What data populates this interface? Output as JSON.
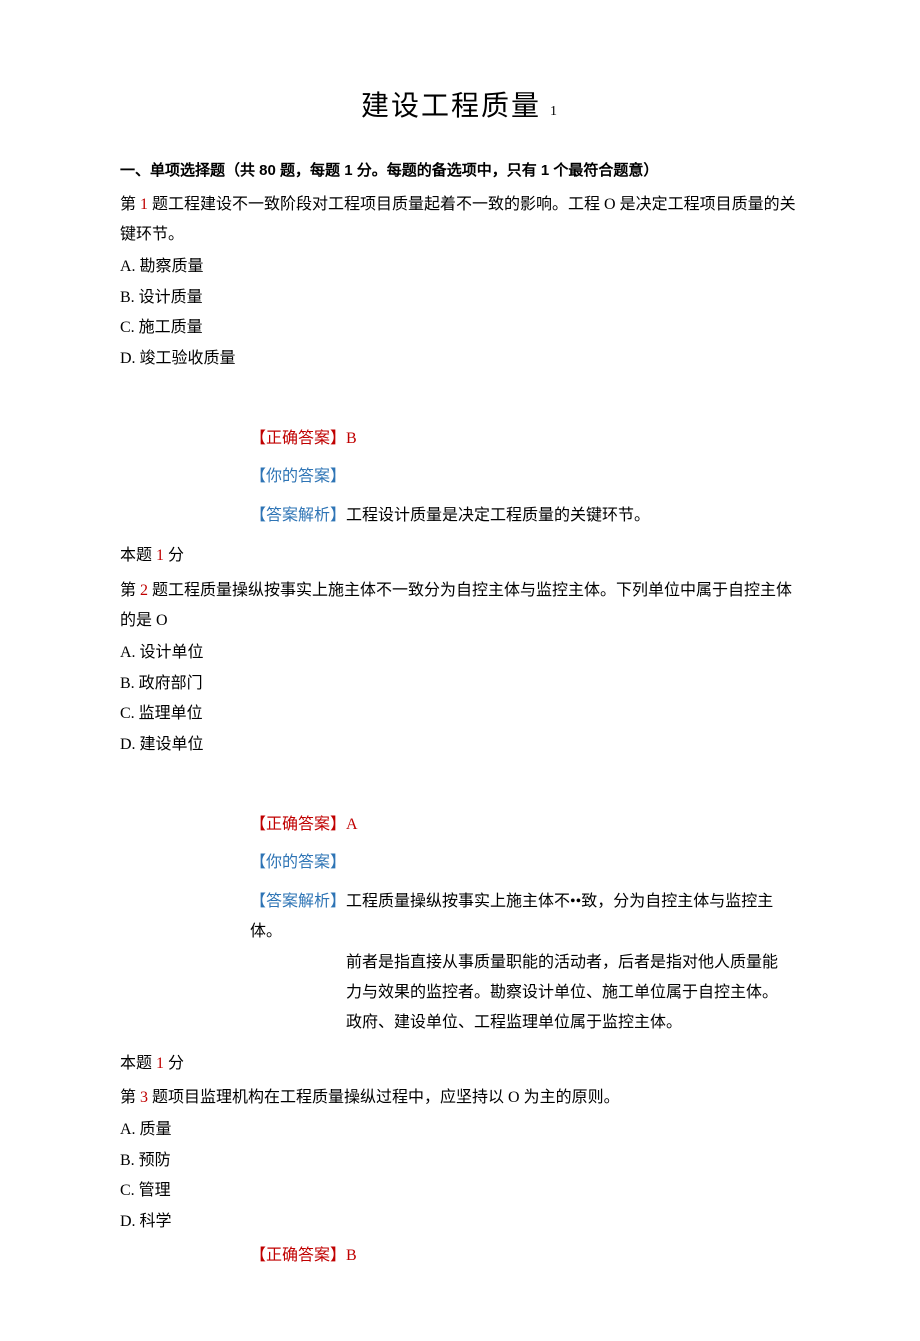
{
  "title_main": "建设工程质量",
  "title_suffix": "1",
  "section_header": "一、单项选择题（共 80 题，每题 1 分。每题的备选项中，只有 1 个最符合题意）",
  "q1": {
    "prefix": "第",
    "num": "1",
    "text": "题工程建设不一致阶段对工程项目质量起着不一致的影响。工程 O 是决定工程项目质量的关键环节。",
    "opt_a": "A. 勘察质量",
    "opt_b": "B. 设计质量",
    "opt_c": "C. 施工质量",
    "opt_d": "D. 竣工验收质量",
    "correct_label": "【正确答案】",
    "correct_value": "B",
    "your_label": "【你的答案】",
    "explain_label": "【答案解析】",
    "explain_text": "工程设计质量是决定工程质量的关键环节。",
    "score_prefix": "本题",
    "score_num": "1",
    "score_suffix": "分"
  },
  "q2": {
    "prefix": "第",
    "num": "2",
    "text": "题工程质量操纵按事实上施主体不一致分为自控主体与监控主体。下列单位中属于自控主体的是 O",
    "opt_a": "A. 设计单位",
    "opt_b": "B. 政府部门",
    "opt_c": "C. 监理单位",
    "opt_d": "D. 建设单位",
    "correct_label": "【正确答案】",
    "correct_value": "A",
    "your_label": "【你的答案】",
    "explain_label": "【答案解析】",
    "explain_line1": "工程质量操纵按事实上施主体不••致，分为自控主体与监控主体。",
    "explain_line2": "前者是指直接从事质量职能的活动者，后者是指对他人质量能",
    "explain_line3": "力与效果的监控者。勘察设计单位、施工单位属于自控主体。",
    "explain_line4": "政府、建设单位、工程监理单位属于监控主体。",
    "score_prefix": "本题",
    "score_num": "1",
    "score_suffix": "分"
  },
  "q3": {
    "prefix": "第",
    "num": "3",
    "text": "题项目监理机构在工程质量操纵过程中，应坚持以 O 为主的原则。",
    "opt_a": "A. 质量",
    "opt_b": "B. 预防",
    "opt_c": "C. 管理",
    "opt_d": "D. 科学",
    "correct_label": "【正确答案】",
    "correct_value": "B"
  }
}
